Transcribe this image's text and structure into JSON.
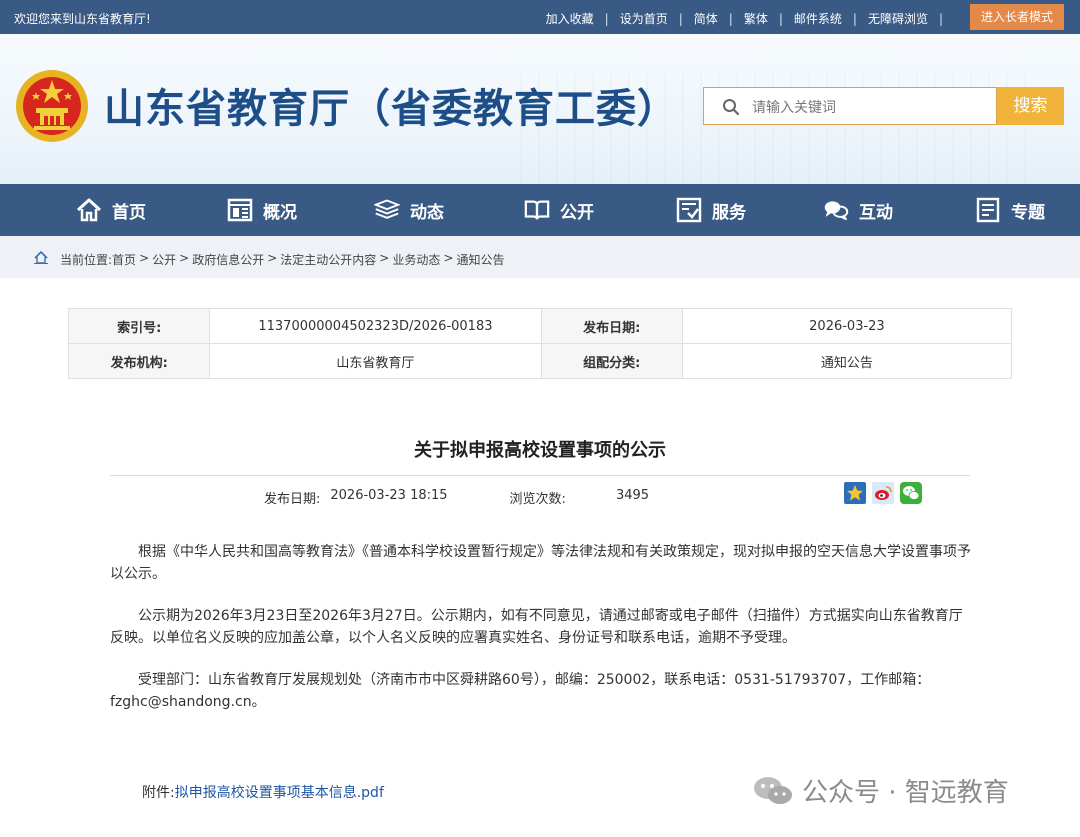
{
  "topbar": {
    "welcome": "欢迎您来到山东省教育厅!",
    "links": [
      "加入收藏",
      "设为首页",
      "简体",
      "繁体",
      "邮件系统",
      "无障碍浏览"
    ],
    "elder_mode": "进入长者模式"
  },
  "header": {
    "title": "山东省教育厅（省委教育工委）",
    "search_placeholder": "请输入关键词",
    "search_button": "搜索"
  },
  "nav": {
    "items": [
      {
        "label": "首页",
        "icon": "home-icon"
      },
      {
        "label": "概况",
        "icon": "overview-icon"
      },
      {
        "label": "动态",
        "icon": "news-icon"
      },
      {
        "label": "公开",
        "icon": "open-book-icon"
      },
      {
        "label": "服务",
        "icon": "service-icon"
      },
      {
        "label": "互动",
        "icon": "chat-icon"
      },
      {
        "label": "专题",
        "icon": "document-icon"
      }
    ]
  },
  "breadcrumb": {
    "prefix": "当前位置:",
    "items": [
      "首页",
      "公开",
      "政府信息公开",
      "法定主动公开内容",
      "业务动态",
      "通知公告"
    ]
  },
  "meta": {
    "index_label": "索引号:",
    "index_value": "11370000004502323D/2026-00183",
    "date_label": "发布日期:",
    "date_value": "2026-03-23",
    "org_label": "发布机构:",
    "org_value": "山东省教育厅",
    "category_label": "组配分类:",
    "category_value": "通知公告"
  },
  "article": {
    "title": "关于拟申报高校设置事项的公示",
    "publish_label": "发布日期:",
    "publish_value": "2026-03-23 18:15",
    "views_label": "浏览次数:",
    "views_value": "3495",
    "paragraphs": [
      "根据《中华人民共和国高等教育法》《普通本科学校设置暂行规定》等法律法规和有关政策规定，现对拟申报的空天信息大学设置事项予以公示。",
      "公示期为2026年3月23日至2026年3月27日。公示期内，如有不同意见，请通过邮寄或电子邮件（扫描件）方式据实向山东省教育厅反映。以单位名义反映的应加盖公章，以个人名义反映的应署真实姓名、身份证号和联系电话，逾期不予受理。",
      "受理部门：山东省教育厅发展规划处（济南市市中区舜耕路60号），邮编：250002，联系电话：0531-51793707，工作邮箱：fzghc@shandong.cn。"
    ],
    "attachment_label": "附件:",
    "attachment_name": "拟申报高校设置事项基本信息.pdf"
  },
  "share_icons": [
    "favorite-star-icon",
    "weibo-icon",
    "wechat-icon"
  ],
  "watermark": "公众号 · 智远教育",
  "colors": {
    "nav_blue": "#3a5a86",
    "title_blue": "#1e4e88",
    "search_orange": "#f1b33a",
    "elder_orange": "#e3894a",
    "link_blue": "#1c56a8"
  }
}
